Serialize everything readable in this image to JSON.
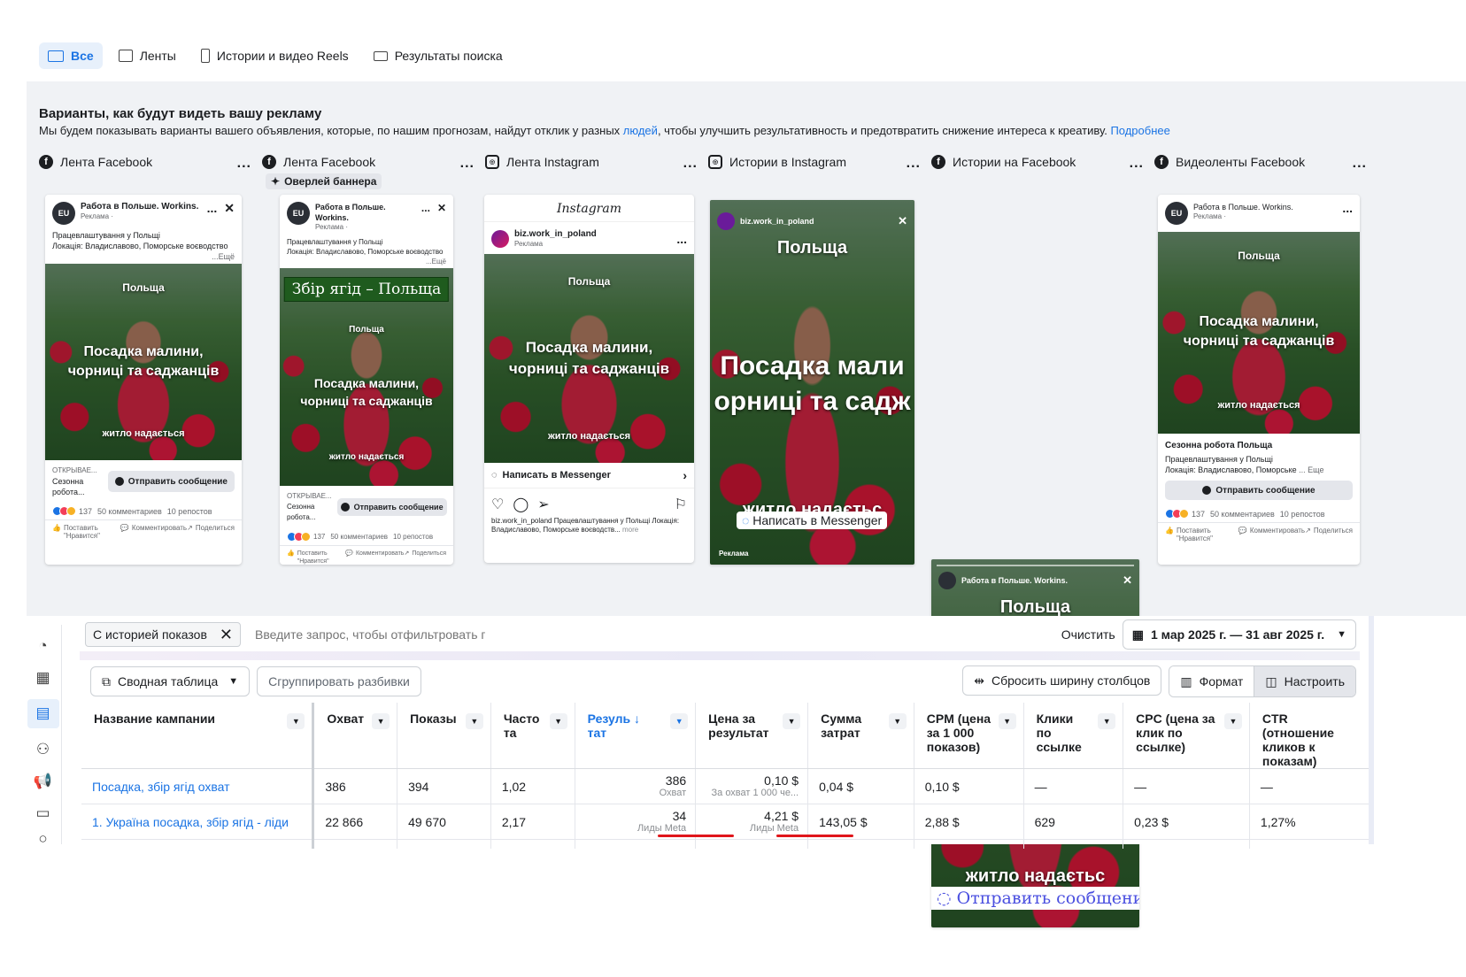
{
  "placement_filter": {
    "tabs": [
      "Все",
      "Ленты",
      "Истории и видео Reels",
      "Результаты поиска"
    ]
  },
  "preview": {
    "title": "Варианты, как будут видеть вашу рекламу",
    "description_before": "Мы будем показывать варианты вашего объявления, которые, по нашим прогнозам, найдут отклик у разных ",
    "description_link": "людей",
    "description_after": ", чтобы улучшить результативность и предотвратить снижение интереса к креативу. ",
    "more_link": "Подробнее",
    "columns": [
      {
        "label": "Лента Facebook",
        "icon": "facebook-icon"
      },
      {
        "label": "Лента Facebook",
        "icon": "facebook-icon",
        "badge": "Оверлей баннера"
      },
      {
        "label": "Лента Instagram",
        "icon": "instagram-icon"
      },
      {
        "label": "Истории в Instagram",
        "icon": "instagram-icon"
      },
      {
        "label": "Истории на Facebook",
        "icon": "facebook-icon"
      },
      {
        "label": "Видеоленты Facebook",
        "icon": "facebook-icon"
      }
    ],
    "menu_dots": "...",
    "page_name": "Работа в Польше. Workins.",
    "sponsored": "Реклама · ",
    "avatar_text": "EU",
    "post_text_1": "Працевлаштування у Польщі",
    "post_text_2": "Локація: Владиславово, Поморське воєводство",
    "post_more": "...Ещё",
    "overlay": {
      "country": "Польща",
      "line1": "Посадка малини,",
      "line2": "чорниці та саджанців",
      "footer": "житло надається",
      "banner": "Збір ягід – Польща",
      "story_line1": "Посадка мали",
      "story_line2": "орниці та садж",
      "story_footer": "житло надаєтьс",
      "story_footer2": "житло надаєтьс"
    },
    "cta_opening": "ОТКРЫВАЕ...",
    "cta_title": "Сезонна робота...",
    "cta_button": "Отправить сообщение",
    "reactions_count": "137",
    "comments": "50 комментариев",
    "reposts": "10 репостов",
    "action_like": "Поставить \"Нравится\"",
    "action_comment": "Комментировать",
    "action_share": "Поделиться",
    "ig_logo": "Instagram",
    "ig_account": "biz.work_in_poland",
    "ig_ad": "Реклама",
    "ig_messenger_cta": "Написать в Messenger",
    "ig_caption": "biz.work_in_poland Працевлаштування у Польщі Локація: Владиславово, Поморське воєводств...",
    "ig_caption_more": "more",
    "story_ig_account": "biz.work_in_poland",
    "story_ig_cta": "Написать в Messenger",
    "story_ad_label": "Реклама",
    "story_fb_cta": "Отправить сообщение",
    "video_title": "Сезонна робота Польща",
    "video_text_1": "Працевлаштування у Польщі",
    "video_text_2": "Локація: Владиславово, Поморське",
    "video_more": "... Еще"
  },
  "ads_manager": {
    "filter_chip": "С историей показов",
    "search_placeholder": "Введите запрос, чтобы отфильтровать по",
    "clear": "Очистить",
    "date_range": "1 мар 2025 г. — 31 авг 2025 г.",
    "view_select": "Сводная таблица",
    "group_breakdowns": "Сгруппировать разбивки",
    "reset_width": "Сбросить ширину столбцов",
    "format": "Формат",
    "customize": "Настроить",
    "columns": [
      "Название кампании",
      "Охват",
      "Показы",
      "Часто та",
      "Резуль ↓ тат",
      "Цена за результат",
      "Сумма затрат",
      "CPM (цена за 1 000 показов)",
      "Клики по ссылке",
      "CPC (цена за клик по ссылке)",
      "CTR (отношение кликов к показам)"
    ],
    "rows": [
      {
        "name": "Посадка, збір ягід охват",
        "reach": "386",
        "impressions": "394",
        "frequency": "1,02",
        "result": "386",
        "result_type": "Охват",
        "cost_per_result": "0,10 $",
        "cost_type": "За охват 1 000 че...",
        "spend": "0,04 $",
        "cpm": "0,10 $",
        "clicks": "—",
        "cpc": "—",
        "ctr": "—"
      },
      {
        "name": "1. Україна посадка, збір ягід - ліди",
        "reach": "22 866",
        "impressions": "49 670",
        "frequency": "2,17",
        "result": "34",
        "result_type": "Лиды Meta",
        "cost_per_result": "4,21 $",
        "cost_type": "Лиды Meta",
        "spend": "143,05 $",
        "cpm": "2,88 $",
        "clicks": "629",
        "cpc": "0,23 $",
        "ctr": "1,27%"
      }
    ]
  },
  "colors": {
    "accent": "#1b74e4",
    "annotation": "#e0161b",
    "panel_bg": "#f0f2f5"
  }
}
